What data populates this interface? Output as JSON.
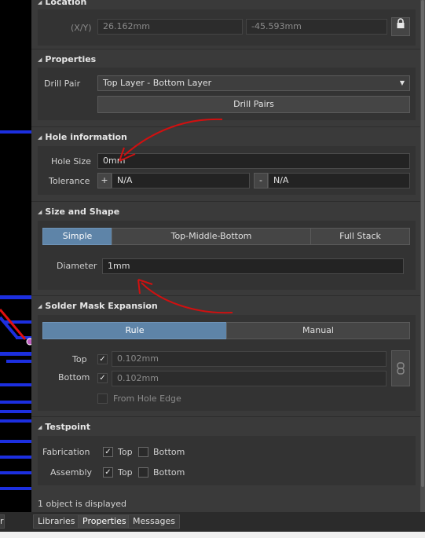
{
  "location": {
    "title": "Location",
    "xy_label": "(X/Y)",
    "x_value": "26.162mm",
    "y_value": "-45.593mm",
    "lock_icon": "lock-icon"
  },
  "properties": {
    "title": "Properties",
    "drill_pair_label": "Drill Pair",
    "drill_pair_value": "Top Layer - Bottom Layer",
    "drill_pairs_button": "Drill Pairs"
  },
  "hole_information": {
    "title": "Hole information",
    "hole_size_label": "Hole Size",
    "hole_size_value": "0mm",
    "tolerance_label": "Tolerance",
    "plus": "+",
    "minus": "-",
    "tol_plus_value": "N/A",
    "tol_minus_value": "N/A"
  },
  "size_and_shape": {
    "title": "Size and Shape",
    "modes": [
      "Simple",
      "Top-Middle-Bottom",
      "Full Stack"
    ],
    "active_mode": "Simple",
    "diameter_label": "Diameter",
    "diameter_value": "1mm"
  },
  "solder_mask": {
    "title": "Solder Mask Expansion",
    "modes": [
      "Rule",
      "Manual"
    ],
    "active_mode": "Rule",
    "top_label": "Top",
    "top_value": "0.102mm",
    "bottom_label": "Bottom",
    "bottom_value": "0.102mm",
    "from_hole_edge_label": "From Hole Edge",
    "link_icon": "link-icon"
  },
  "testpoint": {
    "title": "Testpoint",
    "fabrication_label": "Fabrication",
    "assembly_label": "Assembly",
    "top_label": "Top",
    "bottom_label": "Bottom"
  },
  "status": {
    "text": "1 object is displayed"
  },
  "tabs": {
    "partial": "r",
    "libraries": "Libraries",
    "properties": "Properties",
    "messages": "Messages"
  },
  "colors": {
    "panel_bg": "#3a3a3a",
    "accent_active": "#5e84a8",
    "pcb_trace": "#1c2fe0",
    "annotation_red": "#d01010"
  }
}
